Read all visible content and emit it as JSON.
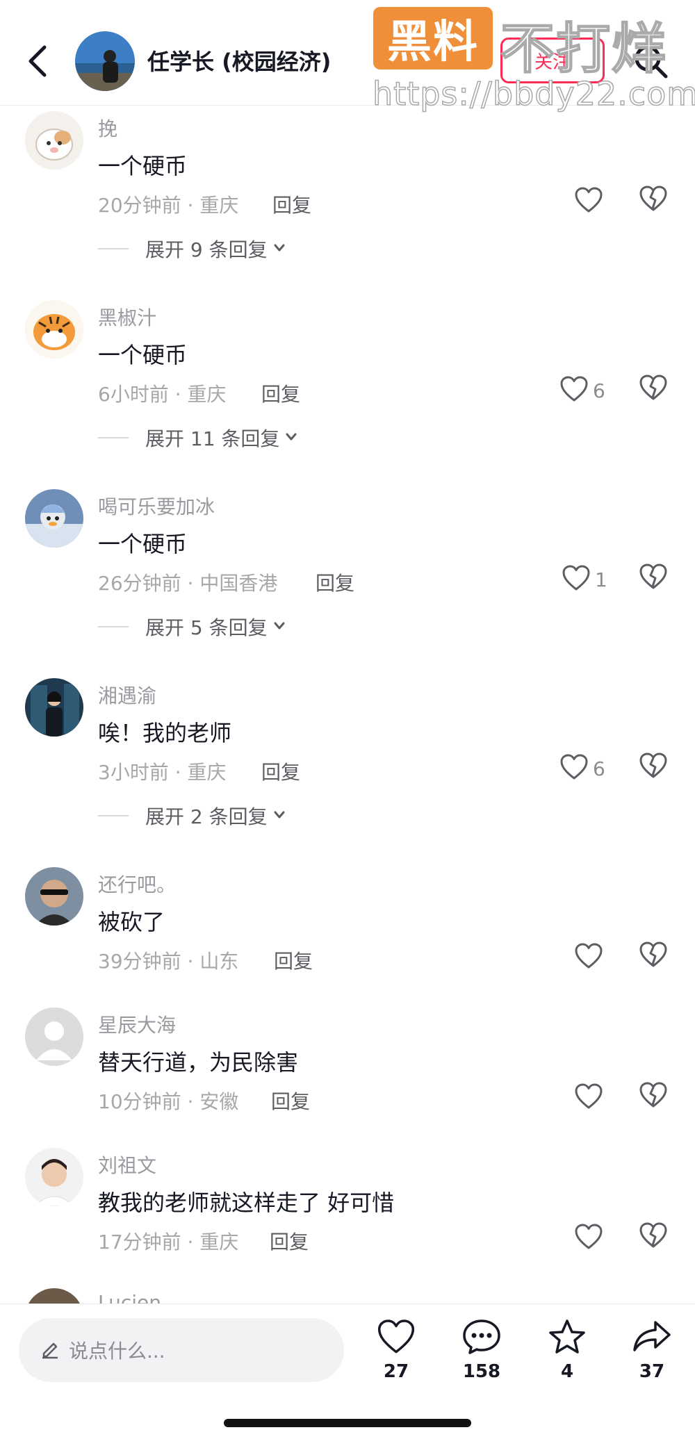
{
  "header": {
    "title": "任学长 (校园经济)",
    "follow_label": "关注"
  },
  "watermark": {
    "box_text": "黑料",
    "side_text": "不打烊",
    "url": "https://bbdy22.com"
  },
  "comments": [
    {
      "name": "挽",
      "text": "一个硬币",
      "meta": "20分钟前 · 重庆",
      "reply": "回复",
      "likes": "",
      "expand": "展开 9 条回复"
    },
    {
      "name": "黑椒汁",
      "text": "一个硬币",
      "meta": "6小时前 · 重庆",
      "reply": "回复",
      "likes": "6",
      "expand": "展开 11 条回复"
    },
    {
      "name": "喝可乐要加冰",
      "text": "一个硬币",
      "meta": "26分钟前 · 中国香港",
      "reply": "回复",
      "likes": "1",
      "expand": "展开 5 条回复"
    },
    {
      "name": "湘遇渝",
      "text": "唉！我的老师",
      "meta": "3小时前 · 重庆",
      "reply": "回复",
      "likes": "6",
      "expand": "展开 2 条回复"
    },
    {
      "name": "还行吧。",
      "text": "被砍了",
      "meta": "39分钟前 · 山东",
      "reply": "回复",
      "likes": ""
    },
    {
      "name": "星辰大海",
      "text": "替天行道，为民除害",
      "meta": "10分钟前 · 安徽",
      "reply": "回复",
      "likes": ""
    },
    {
      "name": "刘祖文",
      "text": "教我的老师就这样走了 好可惜",
      "meta": "17分钟前 · 重庆",
      "reply": "回复",
      "likes": ""
    },
    {
      "name": "Lucien"
    }
  ],
  "bottom": {
    "input_placeholder": "说点什么...",
    "like_count": "27",
    "comment_count": "158",
    "favorite_count": "4",
    "share_count": "37"
  },
  "colors": {
    "accent": "#fe2c55",
    "watermark_orange": "#f08a2f"
  }
}
